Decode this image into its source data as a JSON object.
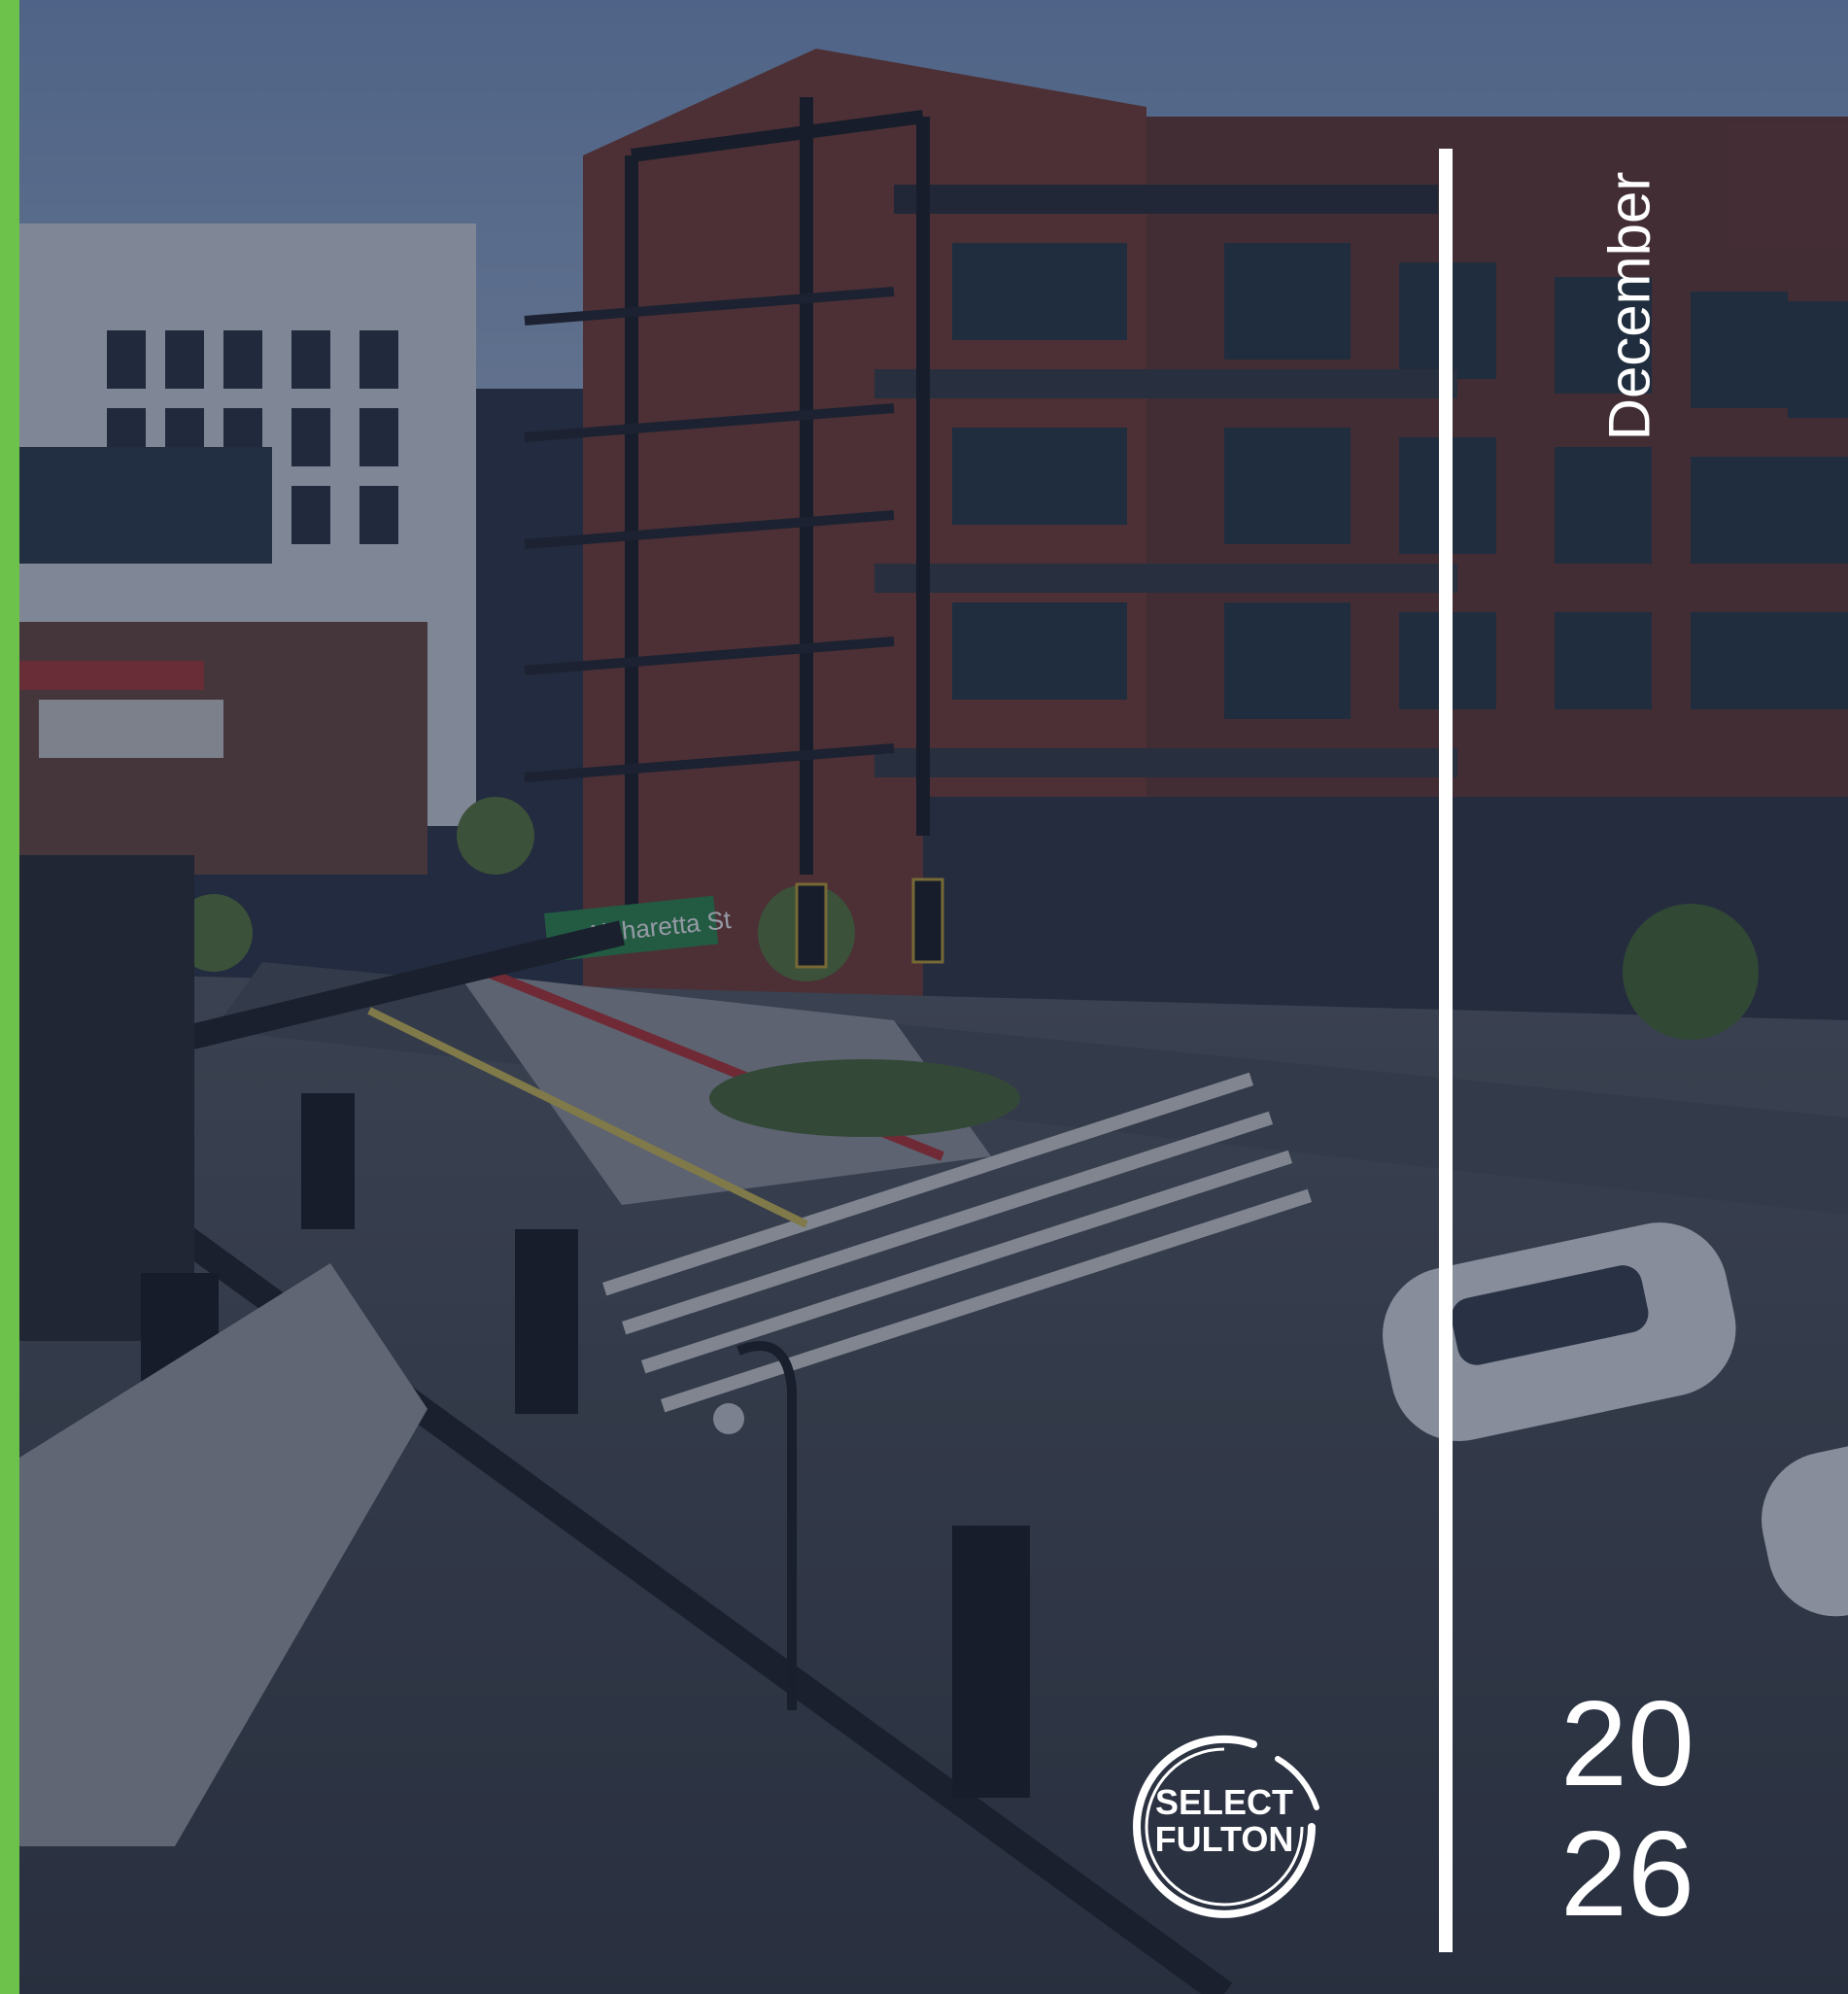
{
  "cover": {
    "month": "December",
    "year_line1": "20",
    "year_line2": "26"
  },
  "logo": {
    "line1": "SELECT",
    "line2": "FULTON"
  },
  "street_sign": {
    "text": "Alpharetta St"
  },
  "colors": {
    "accent_bar": "#6cc24a",
    "overlay": "#1e2a44",
    "text": "#ffffff"
  }
}
